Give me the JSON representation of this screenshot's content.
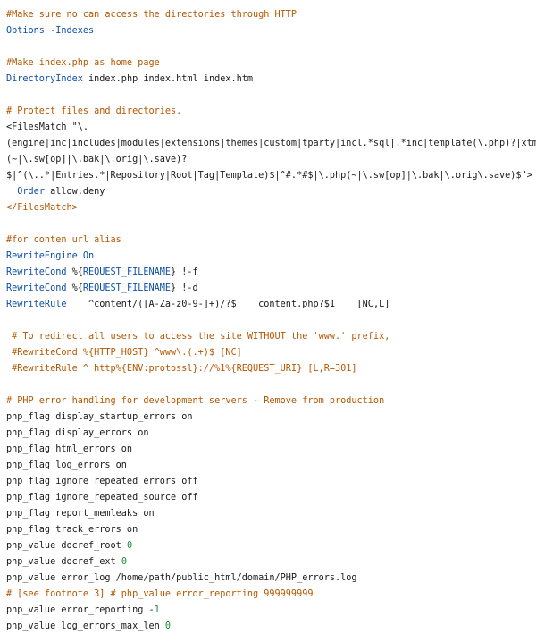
{
  "colors": {
    "background": "#ffffff",
    "comment": "#b65600",
    "keyword": "#0b4fa8",
    "number": "#1f8a3a",
    "text": "#1a1a1a"
  },
  "lines": [
    [
      {
        "cls": "c",
        "text": "#Make sure no can access the directories through HTTP"
      }
    ],
    [
      {
        "cls": "k",
        "text": "Options"
      },
      {
        "cls": "t",
        "text": " -"
      },
      {
        "cls": "k",
        "text": "Indexes"
      }
    ],
    [],
    [
      {
        "cls": "c",
        "text": "#Make index.php as home page"
      }
    ],
    [
      {
        "cls": "k",
        "text": "DirectoryIndex"
      },
      {
        "cls": "t",
        "text": " index.php index.html index.htm"
      }
    ],
    [],
    [
      {
        "cls": "c",
        "text": "# Protect files and directories."
      }
    ],
    [
      {
        "cls": "t",
        "text": "<FilesMatch \"\\."
      }
    ],
    [
      {
        "cls": "t",
        "text": "(engine|inc|includes|modules|extensions|themes|custom|tparty|incl.*sql|.*inc|template(\\.php)?|xtmpl)"
      }
    ],
    [
      {
        "cls": "t",
        "text": "(~|\\.sw[op]|\\.bak|\\.orig|\\.save)?"
      }
    ],
    [
      {
        "cls": "t",
        "text": "$|^(\\..*|Entries.*|Repository|Root|Tag|Template)$|^#.*#$|\\.php(~|\\.sw[op]|\\.bak|\\.orig\\.save)$\">"
      }
    ],
    [
      {
        "cls": "t",
        "text": "  "
      },
      {
        "cls": "k",
        "text": "Order"
      },
      {
        "cls": "t",
        "text": " allow,deny"
      }
    ],
    [
      {
        "cls": "c",
        "text": "</FilesMatch>"
      }
    ],
    [],
    [
      {
        "cls": "c",
        "text": "#for conten url alias"
      }
    ],
    [
      {
        "cls": "k",
        "text": "RewriteEngine"
      },
      {
        "cls": "t",
        "text": " "
      },
      {
        "cls": "k",
        "text": "On"
      }
    ],
    [
      {
        "cls": "k",
        "text": "RewriteCond"
      },
      {
        "cls": "t",
        "text": " %{"
      },
      {
        "cls": "k",
        "text": "REQUEST_FILENAME"
      },
      {
        "cls": "t",
        "text": "} !-f"
      }
    ],
    [
      {
        "cls": "k",
        "text": "RewriteCond"
      },
      {
        "cls": "t",
        "text": " %{"
      },
      {
        "cls": "k",
        "text": "REQUEST_FILENAME"
      },
      {
        "cls": "t",
        "text": "} !-d"
      }
    ],
    [
      {
        "cls": "k",
        "text": "RewriteRule"
      },
      {
        "cls": "t",
        "text": "    ^content/([A-Za-z0-9-]+)/?$    content.php?$1    [NC,L]"
      }
    ],
    [],
    [
      {
        "cls": "c",
        "text": " # To redirect all users to access the site WITHOUT the 'www.' prefix,"
      }
    ],
    [
      {
        "cls": "c",
        "text": " #RewriteCond %{HTTP_HOST} ^www\\.(.+)$ [NC]"
      }
    ],
    [
      {
        "cls": "c",
        "text": " #RewriteRule ^ http%{ENV:protossl}://%1%{REQUEST_URI} [L,R=301]"
      }
    ],
    [],
    [
      {
        "cls": "c",
        "text": "# PHP error handling for development servers - Remove from production"
      }
    ],
    [
      {
        "cls": "t",
        "text": "php_flag display_startup_errors on"
      }
    ],
    [
      {
        "cls": "t",
        "text": "php_flag display_errors on"
      }
    ],
    [
      {
        "cls": "t",
        "text": "php_flag html_errors on"
      }
    ],
    [
      {
        "cls": "t",
        "text": "php_flag log_errors on"
      }
    ],
    [
      {
        "cls": "t",
        "text": "php_flag ignore_repeated_errors off"
      }
    ],
    [
      {
        "cls": "t",
        "text": "php_flag ignore_repeated_source off"
      }
    ],
    [
      {
        "cls": "t",
        "text": "php_flag report_memleaks on"
      }
    ],
    [
      {
        "cls": "t",
        "text": "php_flag track_errors on"
      }
    ],
    [
      {
        "cls": "t",
        "text": "php_value docref_root "
      },
      {
        "cls": "v",
        "text": "0"
      }
    ],
    [
      {
        "cls": "t",
        "text": "php_value docref_ext "
      },
      {
        "cls": "v",
        "text": "0"
      }
    ],
    [
      {
        "cls": "t",
        "text": "php_value error_log /home/path/public_html/domain/PHP_errors.log"
      }
    ],
    [
      {
        "cls": "c",
        "text": "# [see footnote 3] # php_value error_reporting 999999999"
      }
    ],
    [
      {
        "cls": "t",
        "text": "php_value error_reporting -"
      },
      {
        "cls": "v",
        "text": "1"
      }
    ],
    [
      {
        "cls": "t",
        "text": "php_value log_errors_max_len "
      },
      {
        "cls": "v",
        "text": "0"
      }
    ]
  ]
}
